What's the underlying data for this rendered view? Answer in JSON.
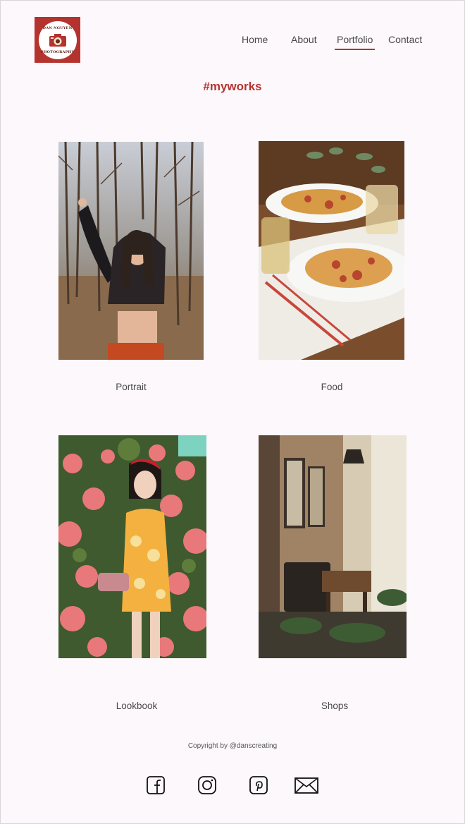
{
  "logo": {
    "text_top": "DAN NGUYEN",
    "text_bottom": "PHOTOGRAPHY",
    "icon": "camera-icon",
    "color": "#b5332e"
  },
  "nav": {
    "items": [
      "Home",
      "About",
      "Portfolio",
      "Contact"
    ],
    "active": "Portfolio"
  },
  "page_title": "#myworks",
  "portfolio": [
    {
      "label": "Portrait"
    },
    {
      "label": "Food"
    },
    {
      "label": "Lookbook"
    },
    {
      "label": "Shops"
    }
  ],
  "footer": {
    "copyright": "Copyright by @danscreating",
    "social_icons": [
      "facebook-icon",
      "instagram-icon",
      "pinterest-icon",
      "mail-icon"
    ]
  }
}
